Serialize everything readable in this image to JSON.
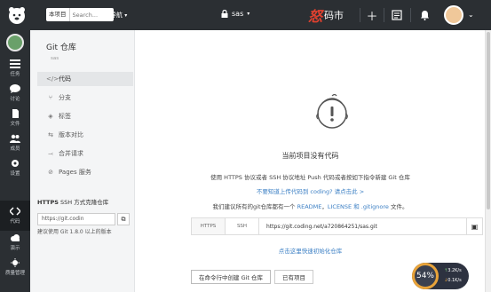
{
  "topbar": {
    "search_scope": "本项目",
    "search_placeholder": "Search...",
    "nav_label": "导航",
    "project_title": "sas",
    "brand_part1": "怒",
    "brand_part2": "码市"
  },
  "rail": {
    "items": [
      {
        "label": "任务"
      },
      {
        "label": "讨论"
      },
      {
        "label": "文件"
      },
      {
        "label": "成员"
      },
      {
        "label": "设置"
      },
      {
        "label": "代码"
      },
      {
        "label": "演示"
      },
      {
        "label": "质量管理"
      }
    ]
  },
  "side": {
    "project_name": "Git 仓库",
    "owner": "sas",
    "menu": [
      {
        "label": "代码",
        "icon": "code-icon"
      },
      {
        "label": "分支",
        "icon": "branch-icon"
      },
      {
        "label": "标签",
        "icon": "tag-icon"
      },
      {
        "label": "版本对比",
        "icon": "compare-icon"
      },
      {
        "label": "合并请求",
        "icon": "merge-icon"
      },
      {
        "label": "Pages 服务",
        "icon": "pages-icon"
      }
    ],
    "clone_title_https": "HTTPS",
    "clone_title_rest": "SSH 方式克隆仓库",
    "clone_url": "https://git.codin",
    "clone_note": "建议使用 Git 1.8.0 以上的版本"
  },
  "main": {
    "empty_title": "当前项目没有代码",
    "line1": "使用 HTTPS 协议或者 SSH 协议地址 Push 代码或者按如下指令新建 Git 仓库",
    "line2_link1": "不要知道上传代码到 coding? ",
    "line2_link2": "请点击此 >",
    "line3_prefix": "我们建议所有的git仓库都有一个 ",
    "line3_readme": "README",
    "line3_sep": "，",
    "line3_license": "LICENSE 和 .gitignore",
    "line3_suffix": " 文件。",
    "url_protocols": [
      "HTTPS",
      "SSH"
    ],
    "url_value": "https://git.coding.net/a720864251/sas.git",
    "quick_init": "点击这里快速初始化仓库",
    "tabs": [
      "在命令行中创建 Git 仓库",
      "已有项目"
    ]
  },
  "widget": {
    "percent": "54%",
    "up": "3.2K/s",
    "down": "0.1K/s"
  }
}
